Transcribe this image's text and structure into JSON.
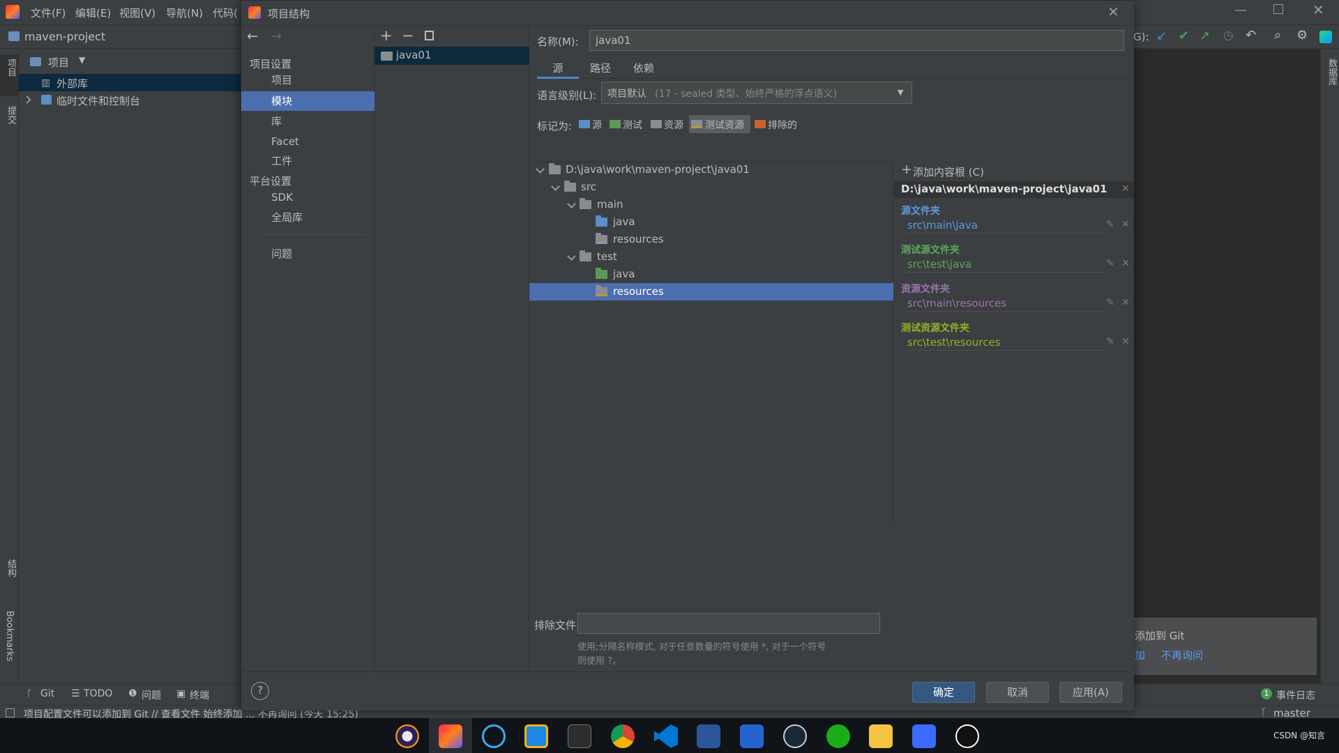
{
  "ide": {
    "menu": [
      "文件(F)",
      "编辑(E)",
      "视图(V)",
      "导航(N)",
      "代码("
    ],
    "project_name": "maven-project",
    "git_label": "G):",
    "project_tool": {
      "header": "项目",
      "items": [
        "外部库",
        "临时文件和控制台"
      ]
    },
    "left_strip": [
      "项目",
      "提交",
      "结构",
      "Bookmarks"
    ],
    "right_strip": [
      "数据库"
    ],
    "bottom_tabs": [
      "Git",
      "TODO",
      "问题",
      "终端"
    ],
    "event_log": "事件日志",
    "event_count": "1",
    "status_text": "项目配置文件可以添加到 Git // 查看文件  始终添加 ... 不再询问 (今天 15:25)",
    "branch": "master",
    "notification": {
      "title": "添加到 Git",
      "add": "加",
      "never": "不再询问"
    },
    "watermark": "CSDN @知言"
  },
  "dialog": {
    "title": "项目结构",
    "nav": {
      "project_settings": "项目设置",
      "project_items": [
        "项目",
        "模块",
        "库",
        "Facet",
        "工件"
      ],
      "selected_index": 1,
      "platform_settings": "平台设置",
      "platform_items": [
        "SDK",
        "全局库"
      ],
      "problems": "问题"
    },
    "module_name": "java01",
    "name_label": "名称(M):",
    "name_value": "java01",
    "tabs": [
      "源",
      "路径",
      "依赖"
    ],
    "active_tab": 0,
    "lang_label": "语言级别(L):",
    "lang_value": "项目默认",
    "lang_hint": "(17 - sealed 类型、始终严格的浮点语义)",
    "mark_label": "标记为:",
    "marks": [
      "源",
      "测试",
      "资源",
      "测试资源",
      "排除的"
    ],
    "tree": [
      {
        "text": "D:\\java\\work\\maven-project\\java01",
        "depth": 0,
        "kind": "plain",
        "expanded": true
      },
      {
        "text": "src",
        "depth": 1,
        "kind": "plain",
        "expanded": true
      },
      {
        "text": "main",
        "depth": 2,
        "kind": "plain",
        "expanded": true
      },
      {
        "text": "java",
        "depth": 3,
        "kind": "source"
      },
      {
        "text": "resources",
        "depth": 3,
        "kind": "resource"
      },
      {
        "text": "test",
        "depth": 2,
        "kind": "plain",
        "expanded": true
      },
      {
        "text": "java",
        "depth": 3,
        "kind": "test"
      },
      {
        "text": "resources",
        "depth": 3,
        "kind": "test-resource",
        "selected": true
      }
    ],
    "add_root": "添加内容根 (C)",
    "root_path": "D:\\java\\work\\maven-project\\java01",
    "roots": [
      {
        "label": "源文件夹",
        "path": "src\\main\\java",
        "color": "#5c9ae0"
      },
      {
        "label": "测试源文件夹",
        "path": "src\\test\\java",
        "color": "#5fa55f"
      },
      {
        "label": "资源文件夹",
        "path": "src\\main\\resources",
        "color": "#9876aa"
      },
      {
        "label": "测试资源文件夹",
        "path": "src\\test\\resources",
        "color": "#8fb32a"
      }
    ],
    "exclude_label": "排除文件:",
    "exclude_hint_1": "使用;分隔名称模式, 对于任意数量的符号使用 *, 对于一个符号",
    "exclude_hint_2": "则使用 ?。",
    "ok": "确定",
    "cancel": "取消",
    "apply": "应用(A)",
    "help": "?"
  },
  "colors": {
    "selection": "#4b6eaf",
    "source": "#5a8fc8",
    "test": "#5b9a55",
    "resource": "#8a8d90",
    "test_resource": "#8a8d90",
    "excluded": "#c8632f",
    "primary_button": "#365880"
  },
  "taskbar_icons": [
    "eclipse-icon",
    "intellij-icon",
    "browser-icon",
    "app-icon",
    "terminal-icon",
    "chrome-icon",
    "vscode-icon",
    "word-icon",
    "todo-icon",
    "steam-icon",
    "wechat-icon",
    "explorer-icon",
    "media-icon",
    "game-icon"
  ]
}
